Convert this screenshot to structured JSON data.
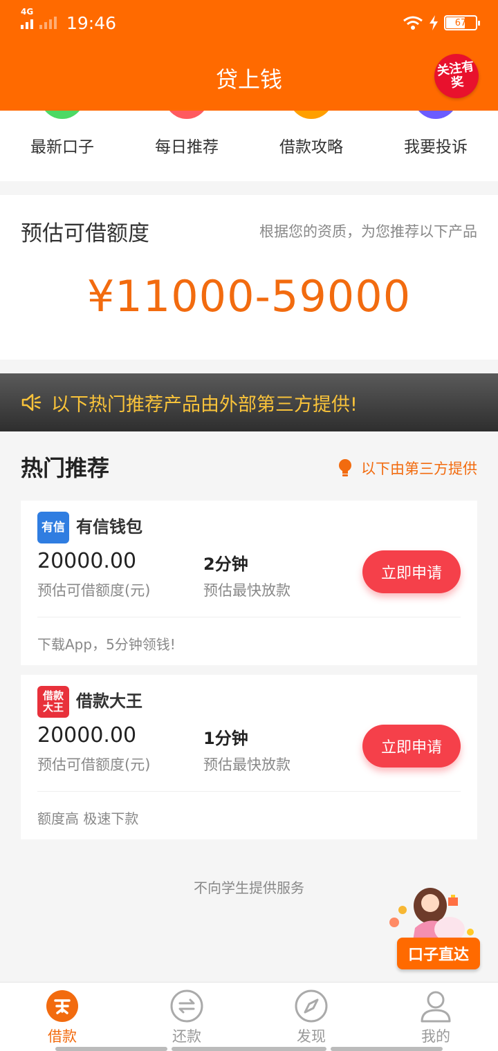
{
  "status_bar": {
    "network": "4G",
    "time": "19:46",
    "battery": "67"
  },
  "header": {
    "title": "贷上钱",
    "promo_badge": "关注有奖"
  },
  "quick_nav": [
    {
      "label": "最新口子",
      "color": "#4cd964"
    },
    {
      "label": "每日推荐",
      "color": "#ff5a5f"
    },
    {
      "label": "借款攻略",
      "color": "#ff9f00"
    },
    {
      "label": "我要投诉",
      "color": "#6b5cff"
    }
  ],
  "estimate": {
    "title": "预估可借额度",
    "subtitle": "根据您的资质，为您推荐以下产品",
    "amount": "¥11000-59000"
  },
  "notice": {
    "text": "以下热门推荐产品由外部第三方提供!"
  },
  "hot": {
    "title": "热门推荐",
    "note": "以下由第三方提供"
  },
  "products": [
    {
      "logo_text": "有信",
      "logo_color": "#2f7de1",
      "name": "有信钱包",
      "amount": "20000.00",
      "amount_label": "预估可借额度(元)",
      "speed": "2分钟",
      "speed_label": "预估最快放款",
      "apply": "立即申请",
      "tagline": "下载App，5分钟领钱!"
    },
    {
      "logo_text": "借款大王",
      "logo_color": "#e8313b",
      "name": "借款大王",
      "amount": "20000.00",
      "amount_label": "预估可借额度(元)",
      "speed": "1分钟",
      "speed_label": "预估最快放款",
      "apply": "立即申请",
      "tagline": "额度高 极速下款"
    }
  ],
  "footer_note": "不向学生提供服务",
  "float_promo": {
    "label": "口子直达"
  },
  "tabs": [
    {
      "label": "借款",
      "icon": "loan-icon",
      "active": true
    },
    {
      "label": "还款",
      "icon": "repay-icon",
      "active": false
    },
    {
      "label": "发现",
      "icon": "compass-icon",
      "active": false
    },
    {
      "label": "我的",
      "icon": "user-icon",
      "active": false
    }
  ],
  "colors": {
    "brand": "#ff6a00",
    "accent": "#f26b0f",
    "button": "#f5404a",
    "notice_text": "#f9c33a"
  }
}
